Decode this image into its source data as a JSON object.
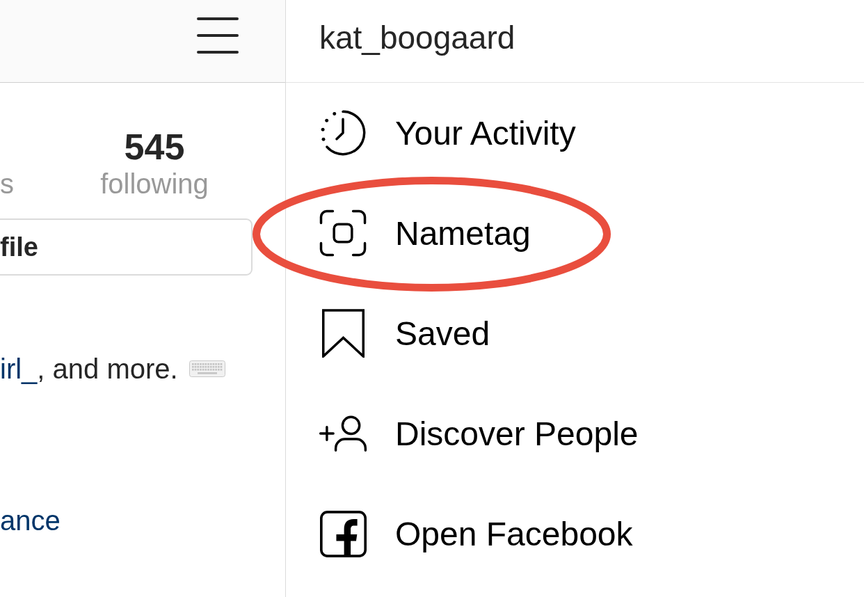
{
  "profile": {
    "stats": [
      {
        "label": "s"
      },
      {
        "count": "545",
        "label": "following"
      }
    ],
    "button": {
      "label": "file"
    },
    "bio": {
      "link": "irl_",
      "text": ", and more."
    },
    "website": "ance"
  },
  "menu": {
    "username": "kat_boogaard",
    "items": [
      {
        "kind": "activity",
        "label": "Your Activity",
        "highlighted": false
      },
      {
        "kind": "nametag",
        "label": "Nametag",
        "highlighted": true
      },
      {
        "kind": "saved",
        "label": "Saved",
        "highlighted": false
      },
      {
        "kind": "discover",
        "label": "Discover People",
        "highlighted": false
      },
      {
        "kind": "facebook",
        "label": "Open Facebook",
        "highlighted": false
      }
    ]
  }
}
